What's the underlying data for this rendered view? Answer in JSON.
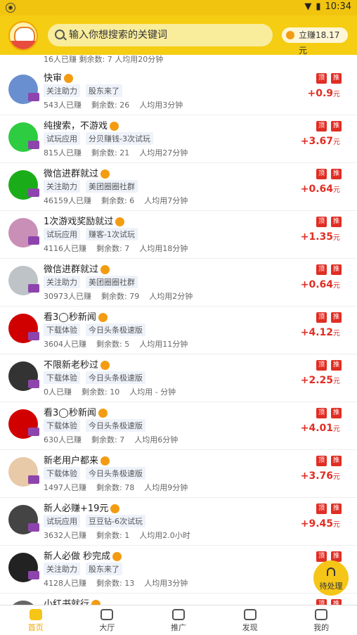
{
  "status": {
    "time": "10:34"
  },
  "header": {
    "search_placeholder": "输入你想搜索的关键词",
    "earn_label": "立赚18.17元"
  },
  "list": {
    "top_meta": "16人已赚   剩余数: 7   人均用20分钟",
    "items": [
      {
        "title": "快审",
        "tags": [
          "关注助力",
          "股东来了"
        ],
        "meta": [
          "543人已赚",
          "剩余数: 26",
          "人均用3分钟"
        ],
        "amount": "+0.9"
      },
      {
        "title": "纯搜索，不游戏",
        "tags": [
          "试玩应用",
          "分贝赚钱-3次试玩"
        ],
        "meta": [
          "815人已赚",
          "剩余数: 21",
          "人均用27分钟"
        ],
        "amount": "+3.67"
      },
      {
        "title": "微信进群就过",
        "tags": [
          "关注助力",
          "美团圈圈社群"
        ],
        "meta": [
          "46159人已赚",
          "剩余数: 6",
          "人均用7分钟"
        ],
        "amount": "+0.64"
      },
      {
        "title": "1次游戏奖励就过",
        "tags": [
          "试玩应用",
          "赚客-1次试玩"
        ],
        "meta": [
          "4116人已赚",
          "剩余数: 7",
          "人均用18分钟"
        ],
        "amount": "+1.35"
      },
      {
        "title": "微信进群就过",
        "tags": [
          "关注助力",
          "美团圈圈社群"
        ],
        "meta": [
          "30973人已赚",
          "剩余数: 79",
          "人均用2分钟"
        ],
        "amount": "+0.64"
      },
      {
        "title": "看3◯秒新闻",
        "tags": [
          "下载体验",
          "今日头条极速版"
        ],
        "meta": [
          "3604人已赚",
          "剩余数: 5",
          "人均用11分钟"
        ],
        "amount": "+4.12"
      },
      {
        "title": "不限新老秒过",
        "tags": [
          "下载体验",
          "今日头条极速版"
        ],
        "meta": [
          "0人已赚",
          "剩余数: 10",
          "人均用 - 分钟"
        ],
        "amount": "+2.25"
      },
      {
        "title": "看3◯秒新闻",
        "tags": [
          "下载体验",
          "今日头条极速版"
        ],
        "meta": [
          "630人已赚",
          "剩余数: 7",
          "人均用6分钟"
        ],
        "amount": "+4.01"
      },
      {
        "title": "新老用户都来",
        "tags": [
          "下载体验",
          "今日头条极速版"
        ],
        "meta": [
          "1497人已赚",
          "剩余数: 78",
          "人均用9分钟"
        ],
        "amount": "+3.76"
      },
      {
        "title": "新人必赚+19元",
        "tags": [
          "试玩应用",
          "豆豆钻-6次试玩"
        ],
        "meta": [
          "3632人已赚",
          "剩余数: 1",
          "人均用2.0小时"
        ],
        "amount": "+9.45"
      },
      {
        "title": "新人必做 秒完成",
        "tags": [
          "关注助力",
          "股东来了"
        ],
        "meta": [
          "4128人已赚",
          "剩余数: 13",
          "人均用3分钟"
        ],
        "amount": ""
      },
      {
        "title": "小红书就行",
        "tags": [],
        "meta": [],
        "amount": ""
      }
    ],
    "mark_top": "顶",
    "mark_recommend": "推",
    "currency": "元"
  },
  "float_button": "待处理",
  "nav": [
    "首页",
    "大厅",
    "推广",
    "发现",
    "我的"
  ],
  "colors": {
    "accent": "#f5cd12",
    "price": "#e02e24"
  }
}
